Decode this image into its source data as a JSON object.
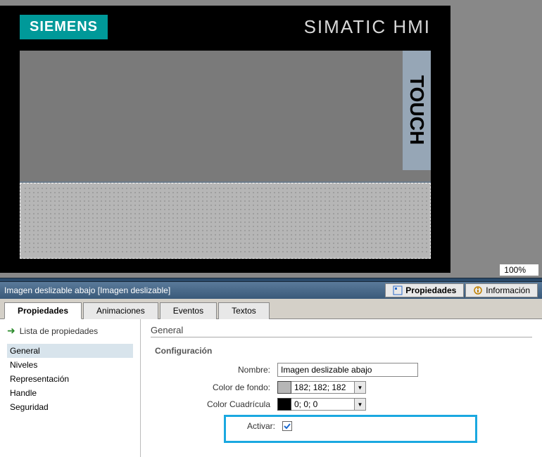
{
  "device": {
    "brand": "SIEMENS",
    "product": "SIMATIC HMI",
    "side_label": "TOUCH"
  },
  "zoom": "100%",
  "titlebar": {
    "object_title": "Imagen deslizable abajo [Imagen deslizable]",
    "right_tabs": {
      "properties": "Propiedades",
      "info": "Información"
    }
  },
  "tabs": {
    "t1": "Propiedades",
    "t2": "Animaciones",
    "t3": "Eventos",
    "t4": "Textos"
  },
  "sidebar": {
    "header": "Lista de propiedades",
    "items": {
      "general": "General",
      "niveles": "Niveles",
      "representacion": "Representación",
      "handle": "Handle",
      "seguridad": "Seguridad"
    }
  },
  "panel": {
    "section": "General",
    "group": "Configuración",
    "labels": {
      "nombre": "Nombre:",
      "fondo": "Color de fondo:",
      "cuadricula": "Color Cuadrícula",
      "activar": "Activar:"
    },
    "values": {
      "nombre": "Imagen deslizable abajo",
      "fondo_rgb": "182; 182; 182",
      "fondo_hex": "#b6b6b6",
      "cuadricula_rgb": "0; 0; 0",
      "cuadricula_hex": "#000000",
      "activar": true
    }
  }
}
